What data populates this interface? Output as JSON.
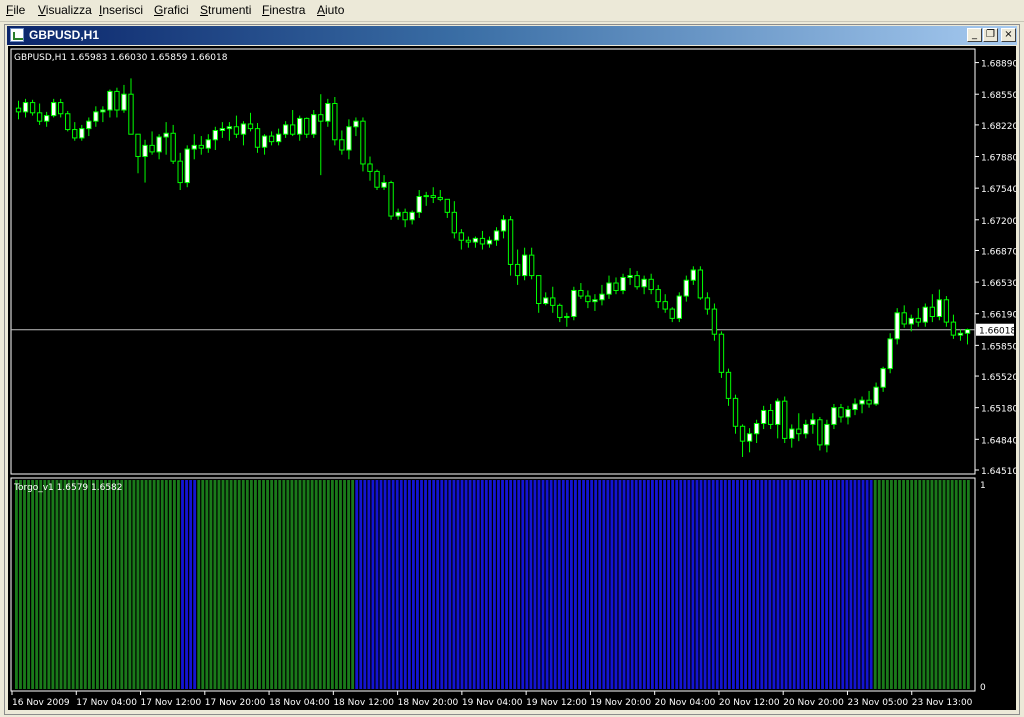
{
  "menu": {
    "items": [
      {
        "label": "File"
      },
      {
        "label": "Visualizza"
      },
      {
        "label": "Inserisci"
      },
      {
        "label": "Grafici"
      },
      {
        "label": "Strumenti"
      },
      {
        "label": "Finestra"
      },
      {
        "label": "Aiuto"
      }
    ]
  },
  "window": {
    "title": "GBPUSD,H1",
    "buttons": {
      "minimize": "_",
      "restore": "❐",
      "close": "×"
    }
  },
  "colors": {
    "background": "#000000",
    "axis": "#ffffff",
    "bull_body": "#ffffff",
    "bear_body": "#000000",
    "wick": "#00ff00",
    "price_line": "#c0c0c0",
    "trend_up": "#1a7a1a",
    "trend_down": "#1414d2"
  },
  "chart_data": [
    {
      "type": "candlestick",
      "symbol": "GBPUSD",
      "timeframe": "H1",
      "header_label": "GBPUSD,H1  1.65983 1.66030 1.65859 1.66018",
      "ohlc_last": {
        "open": 1.65983,
        "high": 1.6603,
        "low": 1.65859,
        "close": 1.66018
      },
      "current_price_label": "1.66018",
      "current_price": 1.66018,
      "y_ticks": [
        "1.68890",
        "1.68550",
        "1.68220",
        "1.67880",
        "1.67540",
        "1.67200",
        "1.66870",
        "1.66530",
        "1.66190",
        "1.65850",
        "1.65520",
        "1.65180",
        "1.64840",
        "1.64510"
      ],
      "ylim": [
        1.6451,
        1.6895
      ],
      "x_ticks": [
        "16 Nov 2009",
        "17 Nov 04:00",
        "17 Nov 12:00",
        "17 Nov 20:00",
        "18 Nov 04:00",
        "18 Nov 12:00",
        "18 Nov 20:00",
        "19 Nov 04:00",
        "19 Nov 12:00",
        "19 Nov 20:00",
        "20 Nov 04:00",
        "20 Nov 12:00",
        "20 Nov 20:00",
        "23 Nov 05:00",
        "23 Nov 13:00"
      ],
      "candles": [
        [
          1.684,
          1.6848,
          1.6828,
          1.6836
        ],
        [
          1.6836,
          1.685,
          1.683,
          1.6846
        ],
        [
          1.6846,
          1.6849,
          1.6832,
          1.6835
        ],
        [
          1.6835,
          1.6845,
          1.6822,
          1.6826
        ],
        [
          1.6826,
          1.6836,
          1.682,
          1.6832
        ],
        [
          1.6832,
          1.685,
          1.683,
          1.6846
        ],
        [
          1.6846,
          1.685,
          1.683,
          1.6834
        ],
        [
          1.6834,
          1.6837,
          1.6815,
          1.6817
        ],
        [
          1.6817,
          1.6825,
          1.6805,
          1.6808
        ],
        [
          1.6808,
          1.6822,
          1.6805,
          1.6818
        ],
        [
          1.6818,
          1.683,
          1.681,
          1.6826
        ],
        [
          1.6826,
          1.6842,
          1.682,
          1.6836
        ],
        [
          1.6836,
          1.6842,
          1.6825,
          1.6838
        ],
        [
          1.6838,
          1.686,
          1.683,
          1.6858
        ],
        [
          1.6858,
          1.6862,
          1.683,
          1.6838
        ],
        [
          1.6838,
          1.6865,
          1.6835,
          1.6855
        ],
        [
          1.6855,
          1.6872,
          1.6812,
          1.6812
        ],
        [
          1.6812,
          1.6812,
          1.677,
          1.6788
        ],
        [
          1.6788,
          1.6806,
          1.676,
          1.68
        ],
        [
          1.68,
          1.6815,
          1.679,
          1.6793
        ],
        [
          1.6793,
          1.6812,
          1.6785,
          1.6809
        ],
        [
          1.6809,
          1.6825,
          1.679,
          1.6813
        ],
        [
          1.6813,
          1.6822,
          1.678,
          1.6783
        ],
        [
          1.6783,
          1.6792,
          1.6752,
          1.676
        ],
        [
          1.676,
          1.68,
          1.6755,
          1.6796
        ],
        [
          1.6796,
          1.6812,
          1.6785,
          1.68
        ],
        [
          1.68,
          1.681,
          1.679,
          1.6797
        ],
        [
          1.6797,
          1.6812,
          1.6792,
          1.6806
        ],
        [
          1.6806,
          1.682,
          1.6795,
          1.6816
        ],
        [
          1.6816,
          1.6825,
          1.6808,
          1.6818
        ],
        [
          1.6818,
          1.6825,
          1.6805,
          1.682
        ],
        [
          1.682,
          1.6832,
          1.6808,
          1.6812
        ],
        [
          1.6812,
          1.6826,
          1.68,
          1.6823
        ],
        [
          1.6823,
          1.6835,
          1.6815,
          1.6818
        ],
        [
          1.6818,
          1.6824,
          1.6792,
          1.6798
        ],
        [
          1.6798,
          1.6812,
          1.679,
          1.681
        ],
        [
          1.681,
          1.6815,
          1.68,
          1.6804
        ],
        [
          1.6804,
          1.6818,
          1.68,
          1.6812
        ],
        [
          1.6812,
          1.6826,
          1.6808,
          1.6822
        ],
        [
          1.6822,
          1.6838,
          1.681,
          1.6812
        ],
        [
          1.6812,
          1.6832,
          1.6805,
          1.6829
        ],
        [
          1.6829,
          1.683,
          1.6808,
          1.6812
        ],
        [
          1.6812,
          1.6838,
          1.6808,
          1.6833
        ],
        [
          1.6833,
          1.6855,
          1.6768,
          1.6826
        ],
        [
          1.6826,
          1.685,
          1.682,
          1.6845
        ],
        [
          1.6845,
          1.6852,
          1.68,
          1.6806
        ],
        [
          1.6806,
          1.6816,
          1.679,
          1.6795
        ],
        [
          1.6795,
          1.6828,
          1.6785,
          1.682
        ],
        [
          1.682,
          1.683,
          1.681,
          1.6826
        ],
        [
          1.6826,
          1.683,
          1.6772,
          1.678
        ],
        [
          1.678,
          1.6788,
          1.6762,
          1.6772
        ],
        [
          1.6772,
          1.6774,
          1.6752,
          1.6755
        ],
        [
          1.6755,
          1.6768,
          1.6752,
          1.676
        ],
        [
          1.676,
          1.6762,
          1.672,
          1.6724
        ],
        [
          1.6724,
          1.6732,
          1.672,
          1.6728
        ],
        [
          1.6728,
          1.6732,
          1.6712,
          1.672
        ],
        [
          1.672,
          1.673,
          1.6715,
          1.6728
        ],
        [
          1.6728,
          1.6752,
          1.6722,
          1.6745
        ],
        [
          1.6745,
          1.675,
          1.6735,
          1.6746
        ],
        [
          1.6746,
          1.6755,
          1.6738,
          1.6744
        ],
        [
          1.6744,
          1.6752,
          1.674,
          1.6742
        ],
        [
          1.6742,
          1.6742,
          1.6722,
          1.6728
        ],
        [
          1.6728,
          1.674,
          1.67,
          1.6706
        ],
        [
          1.6706,
          1.671,
          1.6688,
          1.6698
        ],
        [
          1.6698,
          1.6702,
          1.669,
          1.6696
        ],
        [
          1.6696,
          1.6702,
          1.669,
          1.67
        ],
        [
          1.67,
          1.6708,
          1.6688,
          1.6694
        ],
        [
          1.6694,
          1.6702,
          1.669,
          1.6698
        ],
        [
          1.6698,
          1.6712,
          1.6692,
          1.6708
        ],
        [
          1.6708,
          1.6725,
          1.67,
          1.672
        ],
        [
          1.672,
          1.6724,
          1.666,
          1.6672
        ],
        [
          1.6672,
          1.6688,
          1.665,
          1.666
        ],
        [
          1.666,
          1.669,
          1.6655,
          1.6682
        ],
        [
          1.6682,
          1.669,
          1.6656,
          1.666
        ],
        [
          1.666,
          1.666,
          1.662,
          1.663
        ],
        [
          1.663,
          1.6642,
          1.6628,
          1.6636
        ],
        [
          1.6636,
          1.6648,
          1.662,
          1.6628
        ],
        [
          1.6628,
          1.663,
          1.661,
          1.6615
        ],
        [
          1.6615,
          1.662,
          1.6605,
          1.6616
        ],
        [
          1.6616,
          1.6648,
          1.6612,
          1.6644
        ],
        [
          1.6644,
          1.6652,
          1.6635,
          1.6638
        ],
        [
          1.6638,
          1.6644,
          1.6625,
          1.6632
        ],
        [
          1.6632,
          1.664,
          1.6622,
          1.6634
        ],
        [
          1.6634,
          1.665,
          1.6628,
          1.664
        ],
        [
          1.664,
          1.666,
          1.6635,
          1.6652
        ],
        [
          1.6652,
          1.6658,
          1.664,
          1.6644
        ],
        [
          1.6644,
          1.6662,
          1.664,
          1.6658
        ],
        [
          1.6658,
          1.6668,
          1.665,
          1.666
        ],
        [
          1.666,
          1.6665,
          1.6645,
          1.6648
        ],
        [
          1.6648,
          1.666,
          1.664,
          1.6656
        ],
        [
          1.6656,
          1.6662,
          1.664,
          1.6645
        ],
        [
          1.6645,
          1.665,
          1.6625,
          1.6632
        ],
        [
          1.6632,
          1.664,
          1.662,
          1.6624
        ],
        [
          1.6624,
          1.6626,
          1.661,
          1.6614
        ],
        [
          1.6614,
          1.6642,
          1.661,
          1.6638
        ],
        [
          1.6638,
          1.666,
          1.6632,
          1.6655
        ],
        [
          1.6655,
          1.667,
          1.665,
          1.6666
        ],
        [
          1.6666,
          1.667,
          1.6634,
          1.6636
        ],
        [
          1.6636,
          1.6642,
          1.6618,
          1.6624
        ],
        [
          1.6624,
          1.663,
          1.659,
          1.6597
        ],
        [
          1.6597,
          1.66,
          1.655,
          1.6556
        ],
        [
          1.6556,
          1.656,
          1.652,
          1.6528
        ],
        [
          1.6528,
          1.6532,
          1.649,
          1.6498
        ],
        [
          1.6498,
          1.65,
          1.6465,
          1.6482
        ],
        [
          1.6482,
          1.6496,
          1.647,
          1.649
        ],
        [
          1.649,
          1.6505,
          1.648,
          1.6501
        ],
        [
          1.6501,
          1.652,
          1.6495,
          1.6515
        ],
        [
          1.6515,
          1.6522,
          1.6495,
          1.65
        ],
        [
          1.65,
          1.6528,
          1.6485,
          1.6525
        ],
        [
          1.6525,
          1.653,
          1.648,
          1.6485
        ],
        [
          1.6485,
          1.65,
          1.6475,
          1.6495
        ],
        [
          1.6495,
          1.6512,
          1.6482,
          1.649
        ],
        [
          1.649,
          1.6505,
          1.6485,
          1.65
        ],
        [
          1.65,
          1.6512,
          1.649,
          1.6505
        ],
        [
          1.6505,
          1.6508,
          1.6472,
          1.6478
        ],
        [
          1.6478,
          1.6505,
          1.647,
          1.65
        ],
        [
          1.65,
          1.6522,
          1.6495,
          1.6518
        ],
        [
          1.6518,
          1.6522,
          1.6502,
          1.6508
        ],
        [
          1.6508,
          1.652,
          1.65,
          1.6516
        ],
        [
          1.6516,
          1.6528,
          1.651,
          1.6522
        ],
        [
          1.6522,
          1.653,
          1.6512,
          1.6526
        ],
        [
          1.6526,
          1.6536,
          1.6518,
          1.6522
        ],
        [
          1.6522,
          1.6545,
          1.652,
          1.654
        ],
        [
          1.654,
          1.6562,
          1.6535,
          1.656
        ],
        [
          1.656,
          1.6598,
          1.6555,
          1.6592
        ],
        [
          1.6592,
          1.6625,
          1.6586,
          1.662
        ],
        [
          1.662,
          1.6628,
          1.6604,
          1.6608
        ],
        [
          1.6608,
          1.6618,
          1.66,
          1.6614
        ],
        [
          1.6614,
          1.6625,
          1.6605,
          1.661
        ],
        [
          1.661,
          1.663,
          1.6605,
          1.6626
        ],
        [
          1.6626,
          1.664,
          1.661,
          1.6616
        ],
        [
          1.6616,
          1.6645,
          1.6612,
          1.6634
        ],
        [
          1.6634,
          1.6638,
          1.6605,
          1.661
        ],
        [
          1.661,
          1.6618,
          1.6592,
          1.6596
        ],
        [
          1.6596,
          1.6602,
          1.659,
          1.6598
        ],
        [
          1.6598,
          1.6603,
          1.6586,
          1.6602
        ]
      ]
    },
    {
      "type": "histogram",
      "indicator": "Torgo_v1",
      "header_label": "Torgo_v1 1.6579 1.6582",
      "y_ticks": [
        "1",
        "0"
      ],
      "ylim": [
        0,
        1
      ],
      "bar_value": 1,
      "legend": [
        {
          "name": "up",
          "color": "#1a7a1a"
        },
        {
          "name": "down",
          "color": "#1414d2"
        }
      ],
      "segments": [
        {
          "trend": "up",
          "count": 41
        },
        {
          "trend": "down",
          "count": 4
        },
        {
          "trend": "up",
          "count": 39
        },
        {
          "trend": "down",
          "count": 128
        },
        {
          "trend": "up",
          "count": 24
        }
      ]
    }
  ]
}
